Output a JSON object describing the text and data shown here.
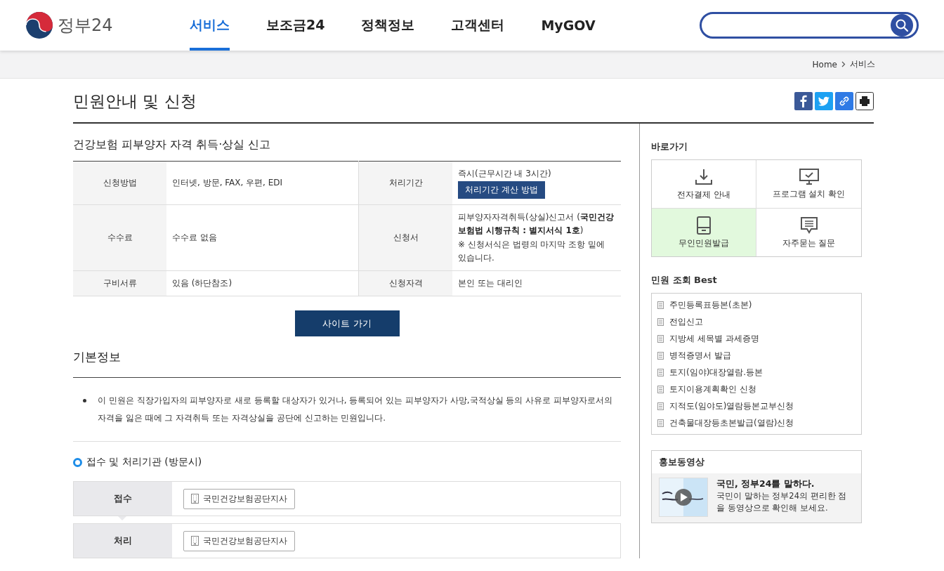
{
  "header": {
    "logo_text": "정부24",
    "nav": [
      {
        "label": "서비스",
        "selected": true
      },
      {
        "label": "보조금24",
        "selected": false
      },
      {
        "label": "정책정보",
        "selected": false
      },
      {
        "label": "고객센터",
        "selected": false
      },
      {
        "label": "MyGOV",
        "selected": false
      }
    ]
  },
  "breadcrumb": [
    "Home",
    "서비스"
  ],
  "page_title": "민원안내 및 신청",
  "service": {
    "title": "건강보험 피부양자 자격 취득·상실 신고",
    "rows": [
      [
        {
          "label": "신청방법",
          "lines": [
            "인터넷, 방문, FAX, 우편, EDI"
          ]
        },
        {
          "label": "처리기간",
          "lines": [
            "즉시(근무시간 내 3시간)"
          ],
          "button": "처리기간 계산 방법"
        }
      ],
      [
        {
          "label": "수수료",
          "lines": [
            "수수료 없음"
          ]
        },
        {
          "label": "신청서",
          "lines": [
            "피부양자자격취득(상실)신고서 (**국민건강보험법 시행규칙 : 별지서식 1호**)",
            "※ 신청서식은 법령의 마지막 조항 밑에 있습니다."
          ]
        }
      ],
      [
        {
          "label": "구비서류",
          "lines": [
            "있음 (하단참조)"
          ]
        },
        {
          "label": "신청자격",
          "lines": [
            "본인 또는 대리인"
          ]
        }
      ]
    ],
    "site_button": "사이트 가기"
  },
  "basic_info": {
    "title": "기본정보",
    "items": [
      "이 민원은 직장가입자의 피부양자로 새로 등록할 대상자가 있거나, 등록되어 있는 피부양자가 사망,국적상실 등의 사유로 피부양자로서의 자격을 잃은 때에 그 자격취득 또는 자격상실을 공단에 신고하는 민원입니다."
    ]
  },
  "agencies": {
    "title": "접수 및 처리기관 (방문시)",
    "rows": [
      {
        "label": "접수",
        "agency": "국민건강보험공단지사"
      },
      {
        "label": "처리",
        "agency": "국민건강보험공단지사"
      }
    ]
  },
  "shortcuts": {
    "title": "바로가기",
    "items": [
      {
        "label": "전자결제 안내",
        "kind": "download",
        "selected": false
      },
      {
        "label": "프로그램 설치 확인",
        "kind": "monitor",
        "selected": false
      },
      {
        "label": "무인민원발급",
        "kind": "kiosk",
        "selected": true
      },
      {
        "label": "자주묻는 질문",
        "kind": "chat",
        "selected": false
      }
    ]
  },
  "best": {
    "title": "민원 조회 Best",
    "items": [
      "주민등록표등본(초본)",
      "전입신고",
      "지방세 세목별 과세증명",
      "병적증명서 발급",
      "토지(임야)대장열람.등본",
      "토지이용계획확인 신청",
      "지적도(임야도)열람등본교부신청",
      "건축물대장등초본발급(열람)신청"
    ]
  },
  "video": {
    "title": "홍보동영상",
    "headline": "국민, 정부24를 말하다.",
    "description": "국민이 말하는 정부24의 편리한 점을 동영상으로 확인해 보세요."
  }
}
